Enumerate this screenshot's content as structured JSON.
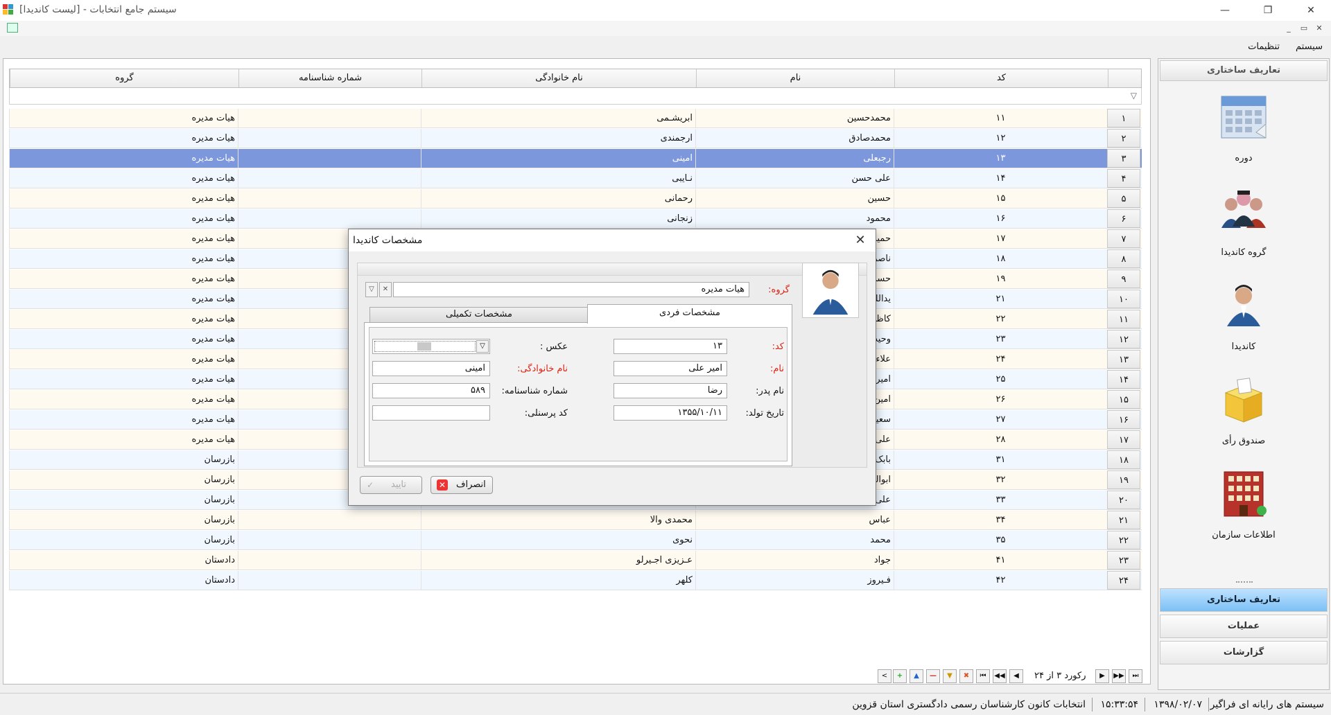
{
  "window": {
    "title": "سیستم جامع انتخابات - [لیست کاندیدا]",
    "minimize": "—",
    "maximize": "❐",
    "close": "✕",
    "mdi_minimize": "_",
    "mdi_restore": "▭",
    "mdi_close": "✕"
  },
  "menu": {
    "items": [
      "سیستم",
      "تنظیمات"
    ]
  },
  "grid": {
    "columns": [
      "کد",
      "نام",
      "نام خانوادگی",
      "شماره شناسنامه",
      "گروه"
    ],
    "filter_icon": "▽",
    "selected_row": 2,
    "rows": [
      {
        "n": "۱",
        "code": "۱۱",
        "name": "محمدحسین",
        "family": "ابریشـمی",
        "sh": "",
        "group": "هیات مدیره"
      },
      {
        "n": "۲",
        "code": "۱۲",
        "name": "محمدصادق",
        "family": "ارجمندی",
        "sh": "",
        "group": "هیات مدیره"
      },
      {
        "n": "۳",
        "code": "۱۳",
        "name": "رجبعلی",
        "family": "امینی",
        "sh": "",
        "group": "هیات مدیره"
      },
      {
        "n": "۴",
        "code": "۱۴",
        "name": "علی حسن",
        "family": "نـایبی",
        "sh": "",
        "group": "هیات مدیره"
      },
      {
        "n": "۵",
        "code": "۱۵",
        "name": "حسین",
        "family": "رحمانی",
        "sh": "",
        "group": "هیات مدیره"
      },
      {
        "n": "۶",
        "code": "۱۶",
        "name": "محمود",
        "family": "زنجانی",
        "sh": "",
        "group": "هیات مدیره"
      },
      {
        "n": "۷",
        "code": "۱۷",
        "name": "حمید",
        "family": "",
        "sh": "",
        "group": "هیات مدیره"
      },
      {
        "n": "۸",
        "code": "۱۸",
        "name": "ناصر",
        "family": "",
        "sh": "",
        "group": "هیات مدیره"
      },
      {
        "n": "۹",
        "code": "۱۹",
        "name": "حسن",
        "family": "",
        "sh": "",
        "group": "هیات مدیره"
      },
      {
        "n": "۱۰",
        "code": "۲۱",
        "name": "یدالله",
        "family": "",
        "sh": "",
        "group": "هیات مدیره"
      },
      {
        "n": "۱۱",
        "code": "۲۲",
        "name": "کاظم",
        "family": "",
        "sh": "",
        "group": "هیات مدیره"
      },
      {
        "n": "۱۲",
        "code": "۲۳",
        "name": "وحید",
        "family": "",
        "sh": "",
        "group": "هیات مدیره"
      },
      {
        "n": "۱۳",
        "code": "۲۴",
        "name": "علاءالدین",
        "family": "",
        "sh": "",
        "group": "هیات مدیره"
      },
      {
        "n": "۱۴",
        "code": "۲۵",
        "name": "امیر",
        "family": "",
        "sh": "",
        "group": "هیات مدیره"
      },
      {
        "n": "۱۵",
        "code": "۲۶",
        "name": "امین",
        "family": "",
        "sh": "",
        "group": "هیات مدیره"
      },
      {
        "n": "۱۶",
        "code": "۲۷",
        "name": "سعید",
        "family": "",
        "sh": "",
        "group": "هیات مدیره"
      },
      {
        "n": "۱۷",
        "code": "۲۸",
        "name": "علی",
        "family": "",
        "sh": "",
        "group": "هیات مدیره"
      },
      {
        "n": "۱۸",
        "code": "۳۱",
        "name": "بابک",
        "family": "",
        "sh": "",
        "group": "بازرسان"
      },
      {
        "n": "۱۹",
        "code": "۳۲",
        "name": "ابوالفضل",
        "family": "",
        "sh": "",
        "group": "بازرسان"
      },
      {
        "n": "۲۰",
        "code": "۳۳",
        "name": "علی",
        "family": "",
        "sh": "",
        "group": "بازرسان"
      },
      {
        "n": "۲۱",
        "code": "۳۴",
        "name": "عباس",
        "family": "محمدی والا",
        "sh": "",
        "group": "بازرسان"
      },
      {
        "n": "۲۲",
        "code": "۳۵",
        "name": "محمد",
        "family": "نحوی",
        "sh": "",
        "group": "بازرسان"
      },
      {
        "n": "۲۳",
        "code": "۴۱",
        "name": "جواد",
        "family": "عـزیزی اجـیرلو",
        "sh": "",
        "group": "دادستان"
      },
      {
        "n": "۲۴",
        "code": "۴۲",
        "name": "فـیروز",
        "family": "کلهر",
        "sh": "",
        "group": "دادستان"
      }
    ]
  },
  "navigator": {
    "record_text": "رکورد ۳ از ۲۴",
    "buttons": [
      "⏮",
      "◀◀",
      "◀",
      "▶",
      "▶▶",
      "⏭",
      "+",
      "▲",
      "—",
      "▼",
      "✖"
    ]
  },
  "sidebar": {
    "header": "تعاریف ساختاری",
    "items": [
      {
        "label": "دوره",
        "icon": "calendar-icon"
      },
      {
        "label": "گروه کاندیدا",
        "icon": "group-icon"
      },
      {
        "label": "کاندیدا",
        "icon": "person-icon"
      },
      {
        "label": "صندوق رأی",
        "icon": "ballot-box-icon"
      },
      {
        "label": "اطلاعات سازمان",
        "icon": "building-icon"
      }
    ],
    "nav": [
      "تعاریف ساختاری",
      "عملیات",
      "گزارشات"
    ]
  },
  "status": {
    "company": "سیستم های رایانه ای فراگیر",
    "date": "۱۳۹۸/۰۲/۰۷",
    "time": "۱۵:۳۳:۵۴",
    "election": "انتخابات کانون کارشناسان رسمی دادگستری استان قزوین"
  },
  "dialog": {
    "title": "مشخصات کاندیدا",
    "close": "✕",
    "group_label": "گروه:",
    "group_value": "هیات مدیره",
    "tabs": [
      "مشخصات فردی",
      "مشخصات تکمیلی"
    ],
    "fields": {
      "code_label": "کد:",
      "code_value": "۱۳",
      "name_label": "نام:",
      "name_value": "امیر علی",
      "father_label": "نام پدر:",
      "father_value": "رضا",
      "birth_label": "تاریخ تولد:",
      "birth_value": "۱۳۵۵/۱۰/۱۱",
      "photo_label": "عکس :",
      "family_label": "نام خانوادگی:",
      "family_value": "امینی",
      "shenasname_label": "شماره شناسنامه:",
      "shenasname_value": "۵۸۹",
      "personnel_label": "کد پرسنلی:",
      "personnel_value": ""
    },
    "cancel_label": "انصراف",
    "ok_label": "تایید"
  },
  "colors": {
    "selected_row": "#7d97dd",
    "required_label": "#dd2211",
    "active_nav": "#7cc0f5"
  }
}
